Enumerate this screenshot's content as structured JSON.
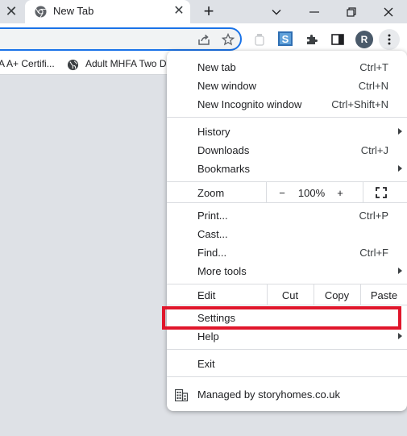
{
  "tab": {
    "title": "New Tab"
  },
  "bookmarks": [
    "A A+ Certifi...",
    "Adult MHFA Two D"
  ],
  "profile": {
    "initial": "R"
  },
  "menu": {
    "new_tab": {
      "label": "New tab",
      "shortcut": "Ctrl+T"
    },
    "new_window": {
      "label": "New window",
      "shortcut": "Ctrl+N"
    },
    "new_incognito": {
      "label": "New Incognito window",
      "shortcut": "Ctrl+Shift+N"
    },
    "history": {
      "label": "History"
    },
    "downloads": {
      "label": "Downloads",
      "shortcut": "Ctrl+J"
    },
    "bookmarks": {
      "label": "Bookmarks"
    },
    "zoom": {
      "label": "Zoom",
      "minus": "−",
      "value": "100%",
      "plus": "+"
    },
    "print": {
      "label": "Print...",
      "shortcut": "Ctrl+P"
    },
    "cast": {
      "label": "Cast..."
    },
    "find": {
      "label": "Find...",
      "shortcut": "Ctrl+F"
    },
    "more_tools": {
      "label": "More tools"
    },
    "edit": {
      "label": "Edit",
      "cut": "Cut",
      "copy": "Copy",
      "paste": "Paste"
    },
    "settings": {
      "label": "Settings"
    },
    "help": {
      "label": "Help"
    },
    "exit": {
      "label": "Exit"
    },
    "managed": {
      "label": "Managed by storyhomes.co.uk"
    }
  },
  "colors": {
    "highlight": "#e0162b",
    "accent": "#1a73e8"
  }
}
